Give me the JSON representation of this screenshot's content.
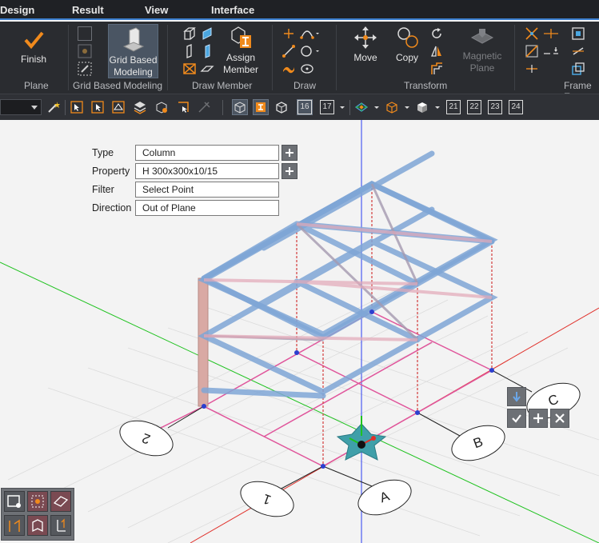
{
  "menu": [
    "Design",
    "Result",
    "View",
    "Interface"
  ],
  "ribbon": {
    "finish": "Finish",
    "grid_based_modeling_1": "Grid Based",
    "grid_based_modeling_2": "Modeling",
    "assign_member_1": "Assign",
    "assign_member_2": "Member",
    "move": "Move",
    "copy": "Copy",
    "magnetic_1": "Magnetic",
    "magnetic_2": "Plane",
    "groups": [
      "Plane",
      "Grid Based Modeling",
      "Draw Member",
      "Draw",
      "Transform",
      "Frame E"
    ]
  },
  "toolbar": {
    "view_buttons": [
      "16",
      "17",
      "21",
      "22",
      "23",
      "24"
    ]
  },
  "properties": {
    "type_label": "Type",
    "type_value": "Column",
    "property_label": "Property",
    "property_value": "H 300x300x10/15",
    "filter_label": "Filter",
    "filter_value": "Select Point",
    "direction_label": "Direction",
    "direction_value": "Out of Plane"
  },
  "grid_labels": [
    "2",
    "1",
    "A",
    "B",
    "C"
  ],
  "colors": {
    "accent_orange": "#f08a1c",
    "beam_blue": "#7fa6d6",
    "grid_pink": "#e0559b",
    "axis_x_red": "#e0302a",
    "axis_y_green": "#1fc21f",
    "axis_z_blue": "#2a3cf0"
  }
}
